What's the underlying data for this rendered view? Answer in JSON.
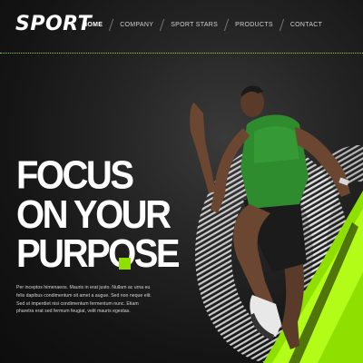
{
  "brand": {
    "logo_text": "SPORT"
  },
  "nav": {
    "items": [
      {
        "label": "HOME",
        "active": true
      },
      {
        "label": "COMPANY",
        "active": false
      },
      {
        "label": "SPORT STARS",
        "active": false
      },
      {
        "label": "PRODUCTS",
        "active": false
      },
      {
        "label": "CONTACT",
        "active": false
      }
    ]
  },
  "hero": {
    "headline": [
      "FOCUS",
      "ON YOUR",
      "PURPOSE"
    ],
    "body": "Per inceptos himenaeos. Mauris in erat justo. Nullam ac urna eu felis dapibus condimentum sit amet a augue. Sed non neque elit. Sed ut imperdiet nisi condimentum fermentum nunc. Etiam pharetra erat sed fermum feugiat, velit mauris egestas."
  },
  "colors": {
    "accent": "#8fe000",
    "background": "#141414",
    "shirt": "#2e8b2e"
  },
  "icons": [
    "runner-image"
  ]
}
